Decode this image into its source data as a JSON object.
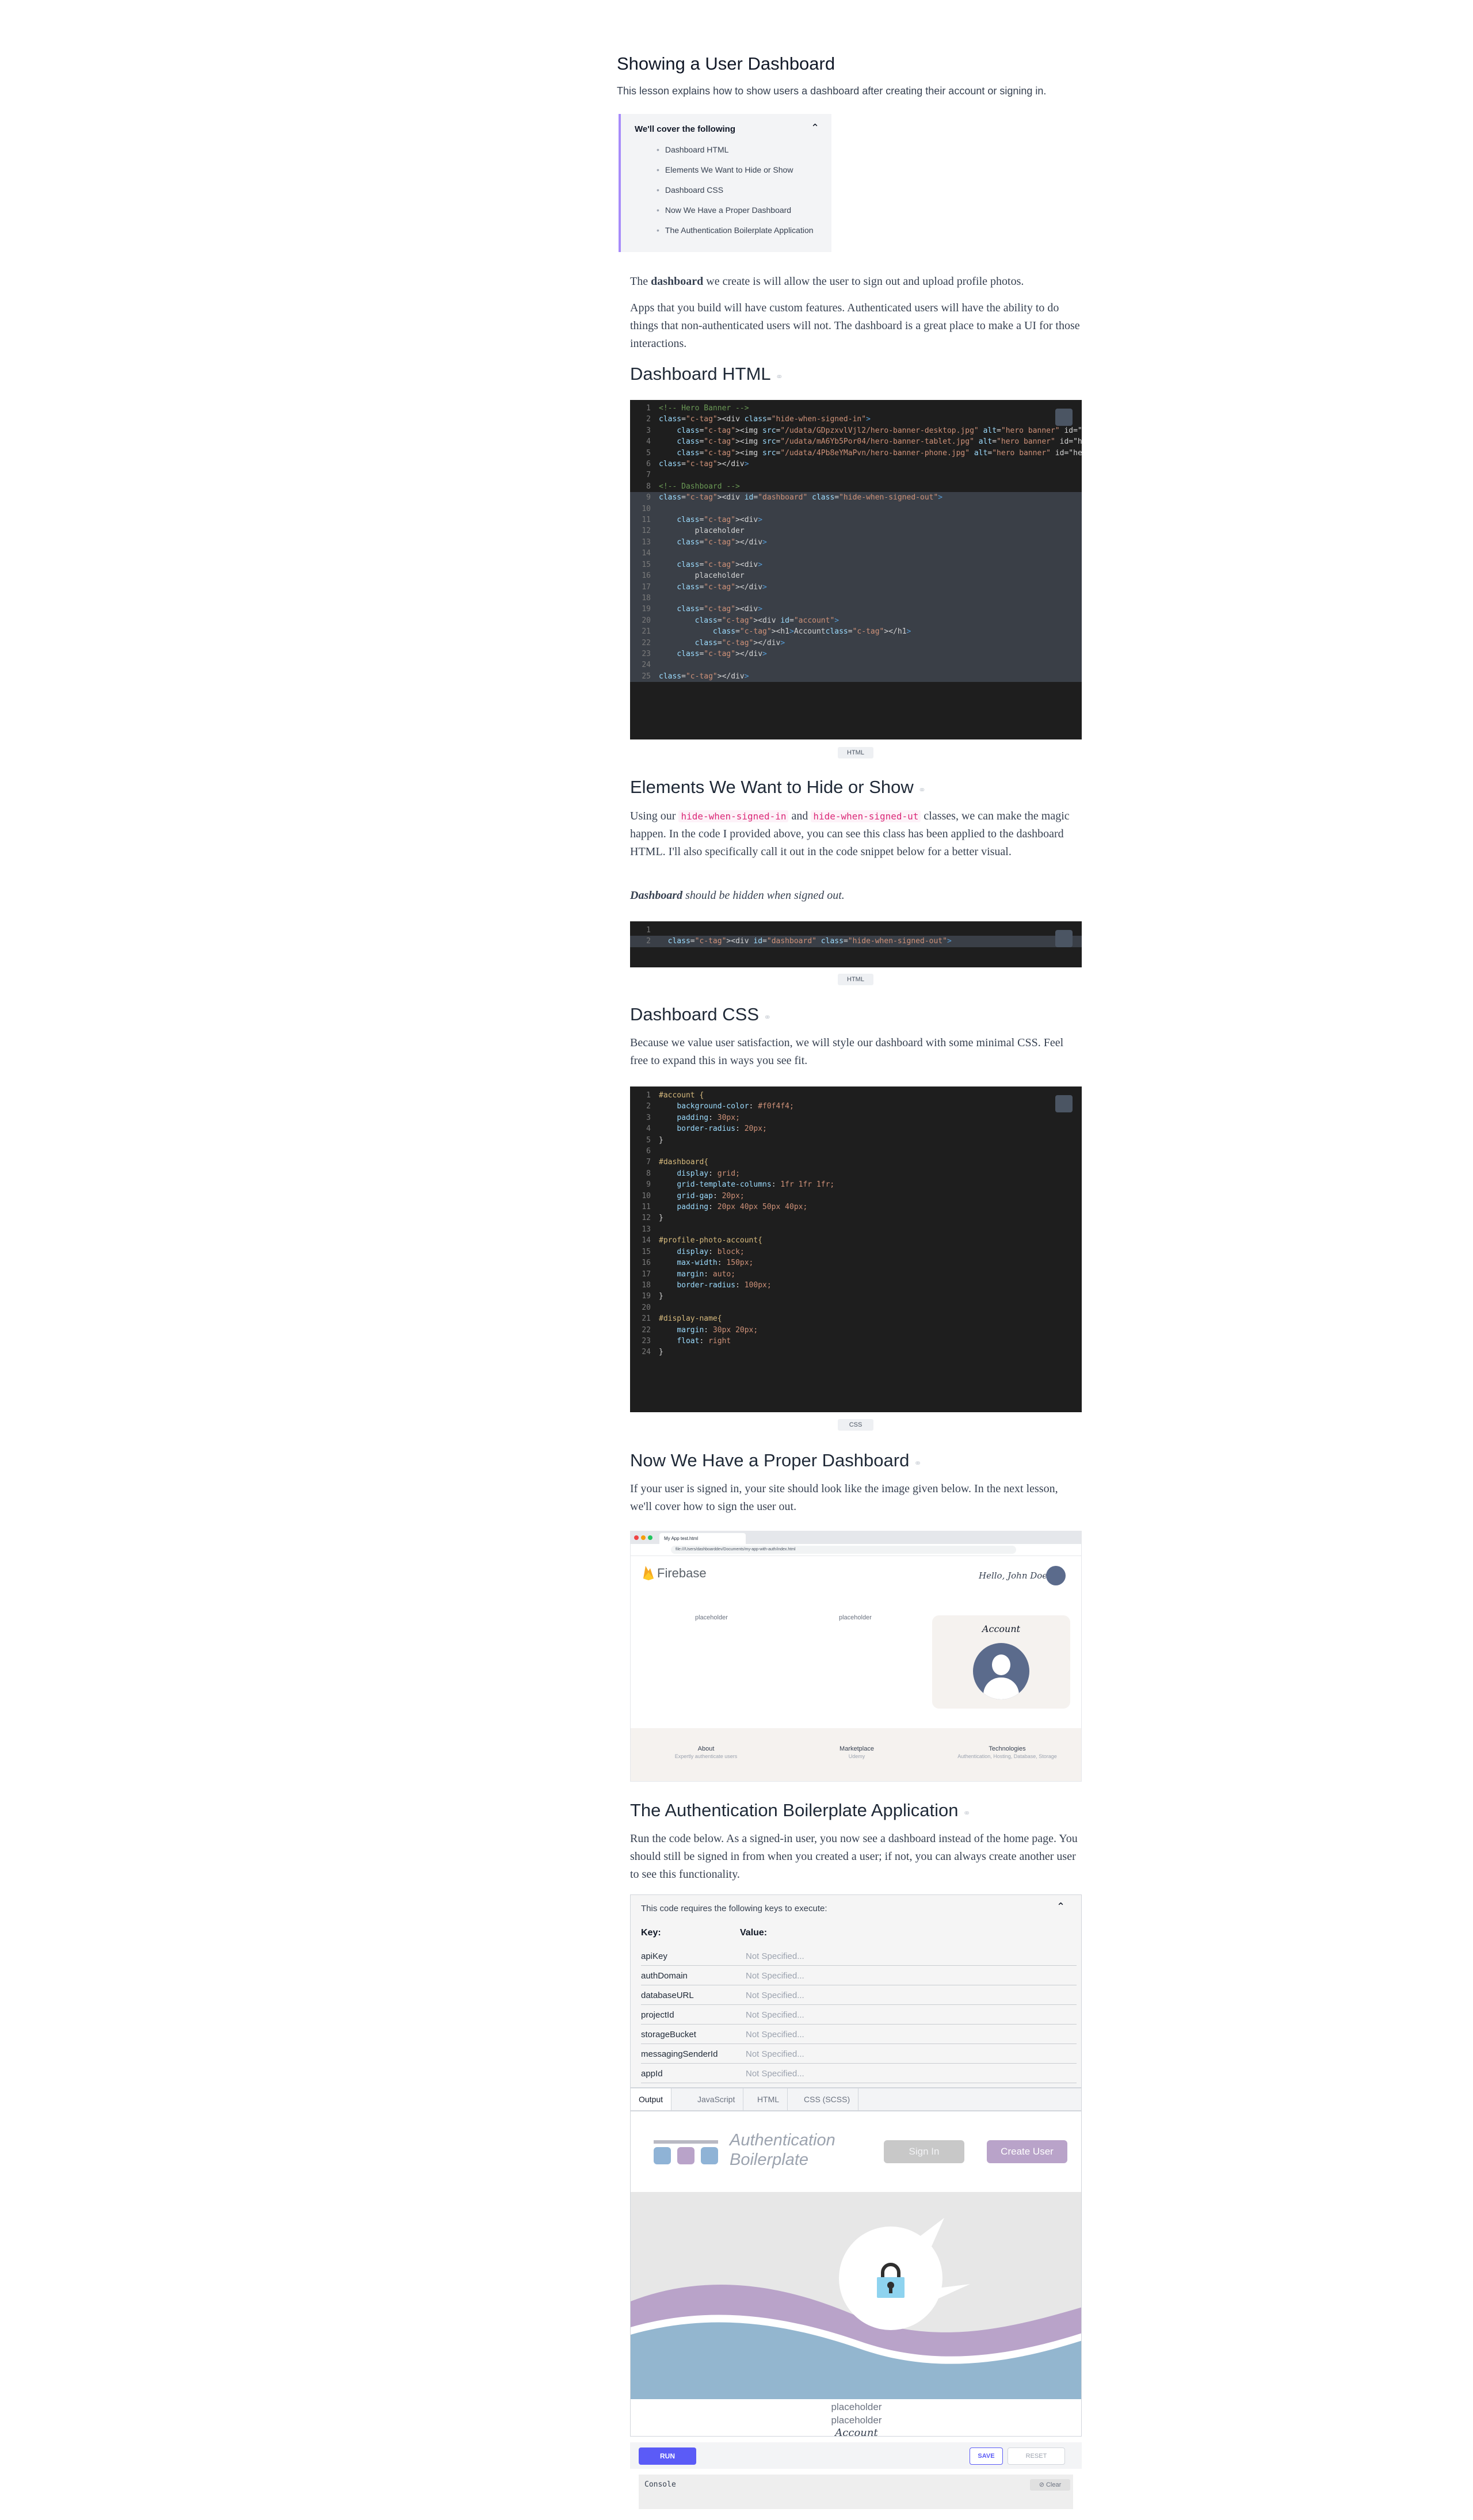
{
  "article": {
    "title": "Showing a User Dashboard",
    "intro": "This lesson explains how to show users a dashboard after creating their account or signing in."
  },
  "toc": {
    "title": "We'll cover the following",
    "items": [
      "Dashboard HTML",
      "Elements We Want to Hide or Show",
      "Dashboard CSS",
      "Now We Have a Proper Dashboard",
      "The Authentication Boilerplate Application"
    ]
  },
  "para1": {
    "pre": "The ",
    "bold": "dashboard",
    "post": " we create is will allow the user to sign out and upload profile photos."
  },
  "para2": "Apps that you build will have custom features. Authenticated users will have the ability to do things that non-authenticated users will not. The dashboard is a great place to make a UI for those interactions.",
  "section1": {
    "title": "Dashboard HTML",
    "lang": "HTML"
  },
  "code1": [
    {
      "n": "1",
      "t": "<!-- Hero Banner -->"
    },
    {
      "n": "2",
      "t": "<div class=\"hide-when-signed-in\">"
    },
    {
      "n": "3",
      "t": "    <img src=\"/udata/GDpzxvlVjl2/hero-banner-desktop.jpg\" alt=\"hero banner\" id=\"hero-banner"
    },
    {
      "n": "4",
      "t": "    <img src=\"/udata/mA6Yb5Por04/hero-banner-tablet.jpg\" alt=\"hero banner\" id=\"hero-banne"
    },
    {
      "n": "5",
      "t": "    <img src=\"/udata/4Pb8eYMaPvn/hero-banner-phone.jpg\" alt=\"hero banner\" id=\"hero-banner"
    },
    {
      "n": "6",
      "t": "</div>"
    },
    {
      "n": "7",
      "t": ""
    },
    {
      "n": "8",
      "t": "<!-- Dashboard -->"
    },
    {
      "n": "9",
      "t": "<div id=\"dashboard\" class=\"hide-when-signed-out\">"
    },
    {
      "n": "10",
      "t": ""
    },
    {
      "n": "11",
      "t": "    <div>"
    },
    {
      "n": "12",
      "t": "        placeholder"
    },
    {
      "n": "13",
      "t": "    </div>"
    },
    {
      "n": "14",
      "t": ""
    },
    {
      "n": "15",
      "t": "    <div>"
    },
    {
      "n": "16",
      "t": "        placeholder"
    },
    {
      "n": "17",
      "t": "    </div>"
    },
    {
      "n": "18",
      "t": ""
    },
    {
      "n": "19",
      "t": "    <div>"
    },
    {
      "n": "20",
      "t": "        <div id=\"account\">"
    },
    {
      "n": "21",
      "t": "            <h1>Account</h1>"
    },
    {
      "n": "22",
      "t": "        </div>"
    },
    {
      "n": "23",
      "t": "    </div>"
    },
    {
      "n": "24",
      "t": ""
    },
    {
      "n": "25",
      "t": "</div>"
    }
  ],
  "section2": {
    "title": "Elements We Want to Hide or Show",
    "p_pre": "Using our ",
    "code_a": "hide-when-signed-in",
    "p_mid": " and ",
    "code_b": "hide-when-signed-ut",
    "p_post": " classes, we can make the magic happen. In the code I provided above, you can see this class has been applied to the dashboard HTML. I'll also specifically call it out in the code snippet below for a better visual.",
    "note_bold": "Dashboard",
    "note_rest": " should be hidden when signed out.",
    "lang": "HTML"
  },
  "code2": [
    {
      "n": "1",
      "t": ""
    },
    {
      "n": "2",
      "t": "  <div id=\"dashboard\" class=\"hide-when-signed-out\">"
    }
  ],
  "section3": {
    "title": "Dashboard CSS",
    "p": "Because we value user satisfaction, we will style our dashboard with some minimal CSS. Feel free to expand this in ways you see fit.",
    "lang": "CSS"
  },
  "code3": [
    {
      "n": "1",
      "t": "#account {"
    },
    {
      "n": "2",
      "t": "    background-color: #f0f4f4;"
    },
    {
      "n": "3",
      "t": "    padding: 30px;"
    },
    {
      "n": "4",
      "t": "    border-radius: 20px;"
    },
    {
      "n": "5",
      "t": "}"
    },
    {
      "n": "6",
      "t": ""
    },
    {
      "n": "7",
      "t": "#dashboard{"
    },
    {
      "n": "8",
      "t": "    display: grid;"
    },
    {
      "n": "9",
      "t": "    grid-template-columns: 1fr 1fr 1fr;"
    },
    {
      "n": "10",
      "t": "    grid-gap: 20px;"
    },
    {
      "n": "11",
      "t": "    padding: 20px 40px 50px 40px;"
    },
    {
      "n": "12",
      "t": "}"
    },
    {
      "n": "13",
      "t": ""
    },
    {
      "n": "14",
      "t": "#profile-photo-account{"
    },
    {
      "n": "15",
      "t": "    display: block;"
    },
    {
      "n": "16",
      "t": "    max-width: 150px;"
    },
    {
      "n": "17",
      "t": "    margin: auto;"
    },
    {
      "n": "18",
      "t": "    border-radius: 100px;"
    },
    {
      "n": "19",
      "t": "}"
    },
    {
      "n": "20",
      "t": ""
    },
    {
      "n": "21",
      "t": "#display-name{"
    },
    {
      "n": "22",
      "t": "    margin: 30px 20px;"
    },
    {
      "n": "23",
      "t": "    float: right"
    },
    {
      "n": "24",
      "t": "}"
    }
  ],
  "section4": {
    "title": "Now We Have a Proper Dashboard",
    "p": "If your user is signed in, your site should look like the image given below. In the next lesson, we'll cover how to sign the user out."
  },
  "screenshot": {
    "tab_label": "My App test.html",
    "url": "file:///Users/dashboarddev/Documents/my-app-with-auth/index.html",
    "brand": "Firebase",
    "greeting": "Hello, John Doe",
    "placeholder1": "placeholder",
    "placeholder2": "placeholder",
    "account": "Account",
    "footer": [
      {
        "label": "About",
        "sub": "Expertly authenticate users"
      },
      {
        "label": "Marketplace",
        "sub": "Udemy"
      },
      {
        "label": "Technologies",
        "sub": "Authentication, Hosting, Database, Storage"
      }
    ]
  },
  "section5": {
    "title": "The Authentication Boilerplate Application",
    "p": "Run the code below. As a signed-in user, you now see a dashboard instead of the home page. You should still be signed in from when you created a user; if not, you can always create another user to see this functionality."
  },
  "keys": {
    "header": "This code requires the following keys to execute:",
    "col_key": "Key:",
    "col_value": "Value:",
    "rows": [
      {
        "key": "apiKey",
        "value": "Not Specified..."
      },
      {
        "key": "authDomain",
        "value": "Not Specified..."
      },
      {
        "key": "databaseURL",
        "value": "Not Specified..."
      },
      {
        "key": "projectId",
        "value": "Not Specified..."
      },
      {
        "key": "storageBucket",
        "value": "Not Specified..."
      },
      {
        "key": "messagingSenderId",
        "value": "Not Specified..."
      },
      {
        "key": "appId",
        "value": "Not Specified..."
      }
    ]
  },
  "tabs": [
    "Output",
    "JavaScript",
    "HTML",
    "CSS (SCSS)"
  ],
  "output": {
    "title_line1": "Authentication",
    "title_line2": "Boilerplate",
    "sign_in": "Sign In",
    "create_user": "Create User",
    "placeholder1": "placeholder",
    "placeholder2": "placeholder",
    "account": "Account"
  },
  "actions": {
    "run": "RUN",
    "save": "SAVE",
    "reset": "RESET"
  },
  "console": {
    "label": "Console",
    "clear": "Clear"
  },
  "colors": {
    "accent": "#a78bfa",
    "run": "#5b5bf7",
    "lavender": "#b9a3c9",
    "wave_blue": "#93b6cf"
  }
}
